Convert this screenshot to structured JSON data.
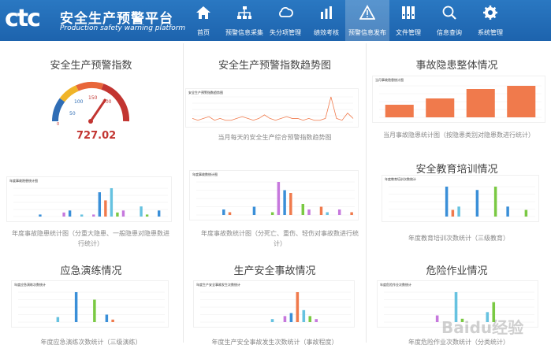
{
  "header": {
    "logo_mark": "ctc",
    "title": "安全生产预警平台",
    "subtitle": "Production safety warning platform"
  },
  "nav": [
    {
      "label": "首页",
      "icon": "home-icon"
    },
    {
      "label": "预警信息采集",
      "icon": "hierarchy-icon"
    },
    {
      "label": "失分项管理",
      "icon": "cloud-icon"
    },
    {
      "label": "绩效考核",
      "icon": "bar-chart-icon"
    },
    {
      "label": "预警信息发布",
      "icon": "warning-icon",
      "active": true
    },
    {
      "label": "文件管理",
      "icon": "binders-icon"
    },
    {
      "label": "信息查询",
      "icon": "search-icon"
    },
    {
      "label": "系统管理",
      "icon": "gear-icon"
    }
  ],
  "panels": {
    "index": {
      "title": "安全生产预警指数",
      "value": "727.02"
    },
    "trend": {
      "title": "安全生产预警指数趋势图",
      "caption": "当月每天的安全生产综合预警指数趋势图",
      "mini_title": "安全生产预警指数趋势图"
    },
    "overall": {
      "title": "事故隐患整体情况",
      "caption": "当月事故隐患统计图（按隐患类别对隐患数进行统计）",
      "mini_title": "当月事故隐患统计图"
    },
    "hazard": {
      "caption": "年度事故隐患统计图（分重大隐患、一般隐患对隐患数进行统计）",
      "mini_title": "年度事故隐患统计图"
    },
    "accident_stats": {
      "caption": "年度事故数统计图（分死亡、重伤、轻伤对事故数进行统计）",
      "mini_title": "年度事故数统计图"
    },
    "training": {
      "title": "安全教育培训情况",
      "caption": "年度教育培训次数统计（三级教育）",
      "mini_title": "年度教育培训次数统计"
    },
    "drill": {
      "title": "应急演练情况",
      "caption": "年度应急演练次数统计（三级演练）",
      "mini_title": "年度应急演练次数统计"
    },
    "accident": {
      "title": "生产安全事故情况",
      "caption": "年度生产安全事故发生次数统计（事故程度）",
      "mini_title": "年度生产安全事故发生次数统计"
    },
    "risk": {
      "title": "危险作业情况",
      "caption": "年度危险作业次数统计（分类统计）",
      "mini_title": "年度危险作业次数统计"
    }
  },
  "watermark": "Baidu经验",
  "chart_data": [
    {
      "type": "gauge",
      "value": 727.02,
      "ticks": [
        "0",
        "50",
        "100",
        "150",
        "200"
      ]
    },
    {
      "type": "line",
      "values": [
        2,
        1,
        2,
        3,
        1,
        2,
        1,
        1,
        2,
        3,
        2,
        1,
        2,
        4,
        2,
        1,
        2,
        3,
        2,
        2,
        1,
        2,
        1,
        1,
        2,
        14,
        2,
        1,
        5,
        2
      ]
    },
    {
      "type": "bar",
      "values": [
        4,
        6,
        9,
        10
      ]
    },
    {
      "type": "bar",
      "values": [
        0,
        0,
        0,
        0,
        1,
        0,
        0,
        0,
        2,
        3,
        0,
        1,
        0,
        1,
        12,
        8,
        14,
        2,
        3,
        0,
        0,
        5,
        1,
        0,
        3,
        0
      ]
    },
    {
      "type": "bar",
      "values": [
        0,
        0,
        0,
        0,
        2,
        1,
        0,
        0,
        0,
        3,
        0,
        0,
        1,
        12,
        9,
        8,
        0,
        4,
        2,
        0,
        3,
        1,
        0,
        2,
        0,
        1
      ]
    },
    {
      "type": "bar",
      "values": [
        0,
        0,
        0,
        0,
        0,
        0,
        0,
        0,
        0,
        9,
        2,
        3,
        0,
        0,
        8,
        0,
        0,
        9,
        0,
        3,
        0,
        0,
        2,
        0
      ]
    },
    {
      "type": "bar",
      "values": [
        0,
        0,
        0,
        0,
        0,
        0,
        2,
        0,
        0,
        12,
        0,
        0,
        9,
        0,
        3,
        1,
        0,
        0,
        0,
        0,
        0,
        0,
        0,
        0
      ]
    },
    {
      "type": "bar",
      "values": [
        0,
        0,
        0,
        0,
        0,
        0,
        0,
        0,
        0,
        0,
        0,
        1,
        0,
        2,
        3,
        10,
        4,
        2,
        1,
        0,
        0,
        0,
        0,
        0
      ]
    },
    {
      "type": "bar",
      "values": [
        0,
        0,
        0,
        0,
        0,
        0,
        0,
        0,
        2,
        0,
        0,
        9,
        1,
        0,
        0,
        0,
        3,
        6,
        0,
        0,
        0,
        0,
        0,
        0
      ]
    }
  ]
}
